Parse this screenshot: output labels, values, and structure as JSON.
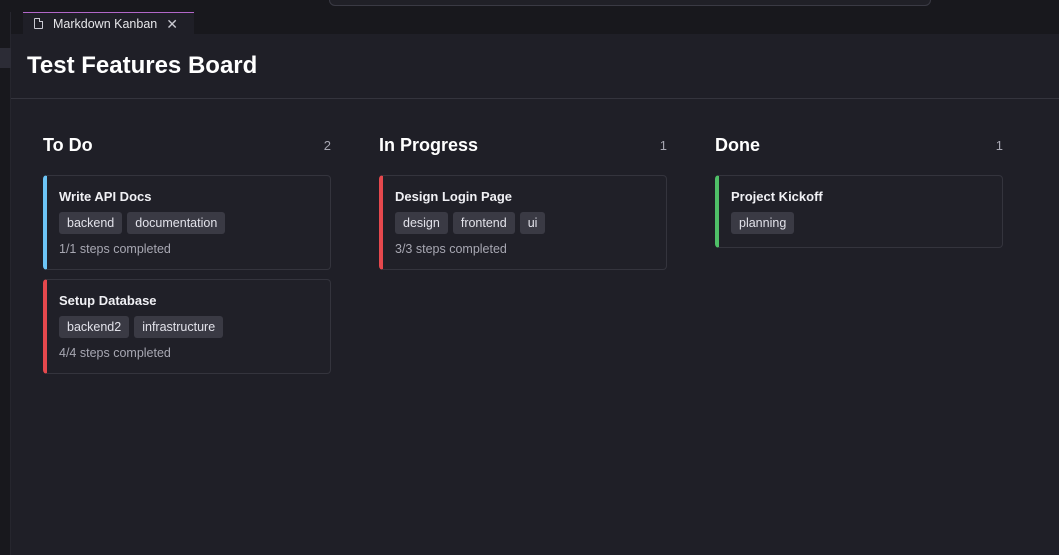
{
  "tab": {
    "title": "Markdown Kanban",
    "close_glyph": "✕"
  },
  "board": {
    "title": "Test Features Board"
  },
  "columns": [
    {
      "title": "To Do",
      "count": "2",
      "cards": [
        {
          "title": "Write API Docs",
          "tags": [
            "backend",
            "documentation"
          ],
          "steps": "1/1 steps completed",
          "accent": "#6cc4f5"
        },
        {
          "title": "Setup Database",
          "tags": [
            "backend2",
            "infrastructure"
          ],
          "steps": "4/4 steps completed",
          "accent": "#e5484d"
        }
      ]
    },
    {
      "title": "In Progress",
      "count": "1",
      "cards": [
        {
          "title": "Design Login Page",
          "tags": [
            "design",
            "frontend",
            "ui"
          ],
          "steps": "3/3 steps completed",
          "accent": "#e5484d"
        }
      ]
    },
    {
      "title": "Done",
      "count": "1",
      "cards": [
        {
          "title": "Project Kickoff",
          "tags": [
            "planning"
          ],
          "steps": "",
          "accent": "#4fbf67"
        }
      ]
    }
  ]
}
